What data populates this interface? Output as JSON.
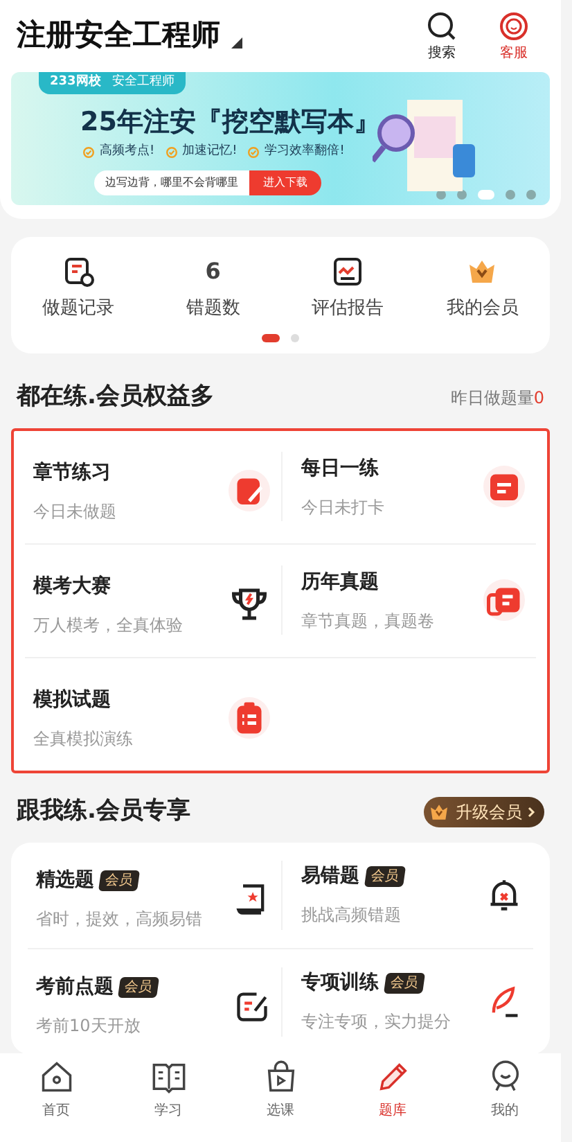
{
  "header": {
    "title": "注册安全工程师",
    "actions": [
      {
        "kind": "search",
        "label": "搜索",
        "highlighted": false
      },
      {
        "kind": "service",
        "label": "客服",
        "highlighted": true
      }
    ]
  },
  "banner": {
    "brand": "233网校",
    "subject": "安全工程师",
    "headline": "25年注安『挖空默写本』",
    "features": [
      "高频考点!",
      "加速记忆!",
      "学习效率翻倍!"
    ],
    "slogan": "边写边背，哪里不会背哪里",
    "cta": "进入下载",
    "dots": [
      {
        "selected": false
      },
      {
        "selected": false
      },
      {
        "selected": true
      },
      {
        "selected": false
      },
      {
        "selected": false
      }
    ]
  },
  "shortcuts": [
    {
      "kind": "record",
      "label": "做题记录"
    },
    {
      "kind": "count",
      "value": "6",
      "label": "错题数"
    },
    {
      "kind": "report",
      "label": "评估报告"
    },
    {
      "kind": "member",
      "label": "我的会员"
    }
  ],
  "shortcut_pages": [
    {
      "selected": true
    },
    {
      "selected": false
    }
  ],
  "practice": {
    "title": "都在练.会员权益多",
    "stat_label": "昨日做题量",
    "stat_value": "0",
    "items": [
      {
        "kind": "chapter",
        "title": "章节练习",
        "subtitle": "今日未做题"
      },
      {
        "kind": "calendar",
        "title": "每日一练",
        "subtitle": "今日未打卡"
      },
      {
        "kind": "trophy",
        "title": "模考大赛",
        "subtitle": "万人模考，全真体验"
      },
      {
        "kind": "papers",
        "title": "历年真题",
        "subtitle": "章节真题，真题卷"
      },
      {
        "kind": "clipboard",
        "title": "模拟试题",
        "subtitle": "全真模拟演练"
      }
    ]
  },
  "member": {
    "title": "跟我练.会员专享",
    "upgrade": "升级会员",
    "items": [
      {
        "kind": "scroll",
        "title": "精选题",
        "badge": "会员",
        "subtitle": "省时，提效，高频易错"
      },
      {
        "kind": "bell",
        "title": "易错题",
        "badge": "会员",
        "subtitle": "挑战高频错题"
      },
      {
        "kind": "note",
        "title": "考前点题",
        "badge": "会员",
        "subtitle": "考前10天开放"
      },
      {
        "kind": "quill",
        "title": "专项训练",
        "badge": "会员",
        "subtitle": "专注专项，实力提分"
      }
    ]
  },
  "tabbar": [
    {
      "kind": "home",
      "label": "首页",
      "selected": false
    },
    {
      "kind": "book",
      "label": "学习",
      "selected": false
    },
    {
      "kind": "bag",
      "label": "选课",
      "selected": false
    },
    {
      "kind": "pen",
      "label": "题库",
      "selected": true
    },
    {
      "kind": "face",
      "label": "我的",
      "selected": false
    }
  ]
}
